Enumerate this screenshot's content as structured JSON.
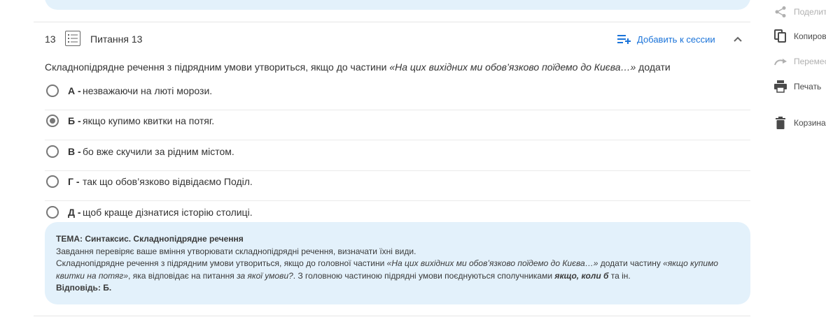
{
  "question": {
    "number": "13",
    "title": "Питання 13",
    "add_to_session": "Добавить к сессии",
    "text_before": "Складнопідрядне речення з підрядним умови утвориться, якщо до частини ",
    "text_quote": "«На цих вихідних ми обов’язково поїдемо до Києва…»",
    "text_after": " додати",
    "options": [
      {
        "letter": "А -",
        "text": "незважаючи на люті морози.",
        "selected": false
      },
      {
        "letter": "Б -",
        "text": "якщо купимо квитки на потяг.",
        "selected": true
      },
      {
        "letter": "В -",
        "text": "бо вже скучили за рідним містом.",
        "selected": false
      },
      {
        "letter": "Г -",
        "text": "так що обов’язково відвідаємо Поділ.",
        "selected": false
      },
      {
        "letter": "Д -",
        "text": "щоб краще дізнатися історію столиці.",
        "selected": false
      }
    ]
  },
  "explanation": {
    "topic": "ТЕМА: Синтаксис. Складнопідрядне речення",
    "line1": "Завдання перевіряє ваше вміння утворювати складнопідрядні речення, визначати їхні види.",
    "line2_a": "Складнопідрядне речення з підрядним умови утвориться, якщо до головної частини ",
    "line2_b": "«На цих вихідних ми обов’язково поїдемо до Києва…»",
    "line2_c": " додати частину ",
    "line2_d": "«якщо купимо квитки на потяг»",
    "line2_e": ", яка відповідає на питання ",
    "line2_f": "за якої умови?",
    "line2_g": ". З головною частиною підрядні умови поєднуються сполучниками ",
    "line2_h": "якщо, коли б",
    "line2_i": " та ін.",
    "answer": "Відповідь: Б."
  },
  "sidebar": {
    "share": "Поделиться",
    "copy": "Копировать",
    "move": "Переместить",
    "print": "Печать",
    "trash": "Корзина"
  },
  "colors": {
    "accent": "#1a73d9",
    "explanation_bg": "#e3f1fb"
  }
}
